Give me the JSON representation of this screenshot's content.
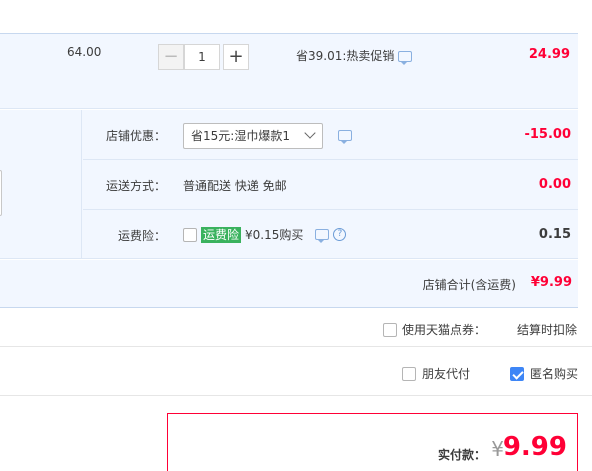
{
  "item": {
    "unit_price": "64.00",
    "quantity": "1",
    "minus_label": "−",
    "plus_label": "+",
    "promo": "省39.01:热卖促销",
    "total": "24.99"
  },
  "store": {
    "discount_label": "店铺优惠：",
    "discount_select": "省15元:湿巾爆款1",
    "discount_value": "-15.00",
    "shipping_label": "运送方式：",
    "shipping_value_text": "普通配送 快递 免邮",
    "shipping_value": "0.00",
    "insurance_label": "运费险：",
    "insurance_tag": "运费险",
    "insurance_text": "¥0.15购买",
    "insurance_help": "?",
    "insurance_value": "0.15",
    "subtotal_label": "店铺合计(含运费)",
    "subtotal_value": "¥9.99"
  },
  "coupon": {
    "label": "使用天猫点券：",
    "right_text": "结算时扣除"
  },
  "payment": {
    "friend_label": "朋友代付",
    "anonymous_label": "匿名购买"
  },
  "final": {
    "label": "实付款：",
    "currency": "¥",
    "value": "9.99"
  },
  "colors": {
    "accent_red": "#ff0036",
    "row_bg": "#f2f7ff",
    "checkbox_blue": "#3e86f6",
    "insurance_green": "#3ab25e"
  }
}
